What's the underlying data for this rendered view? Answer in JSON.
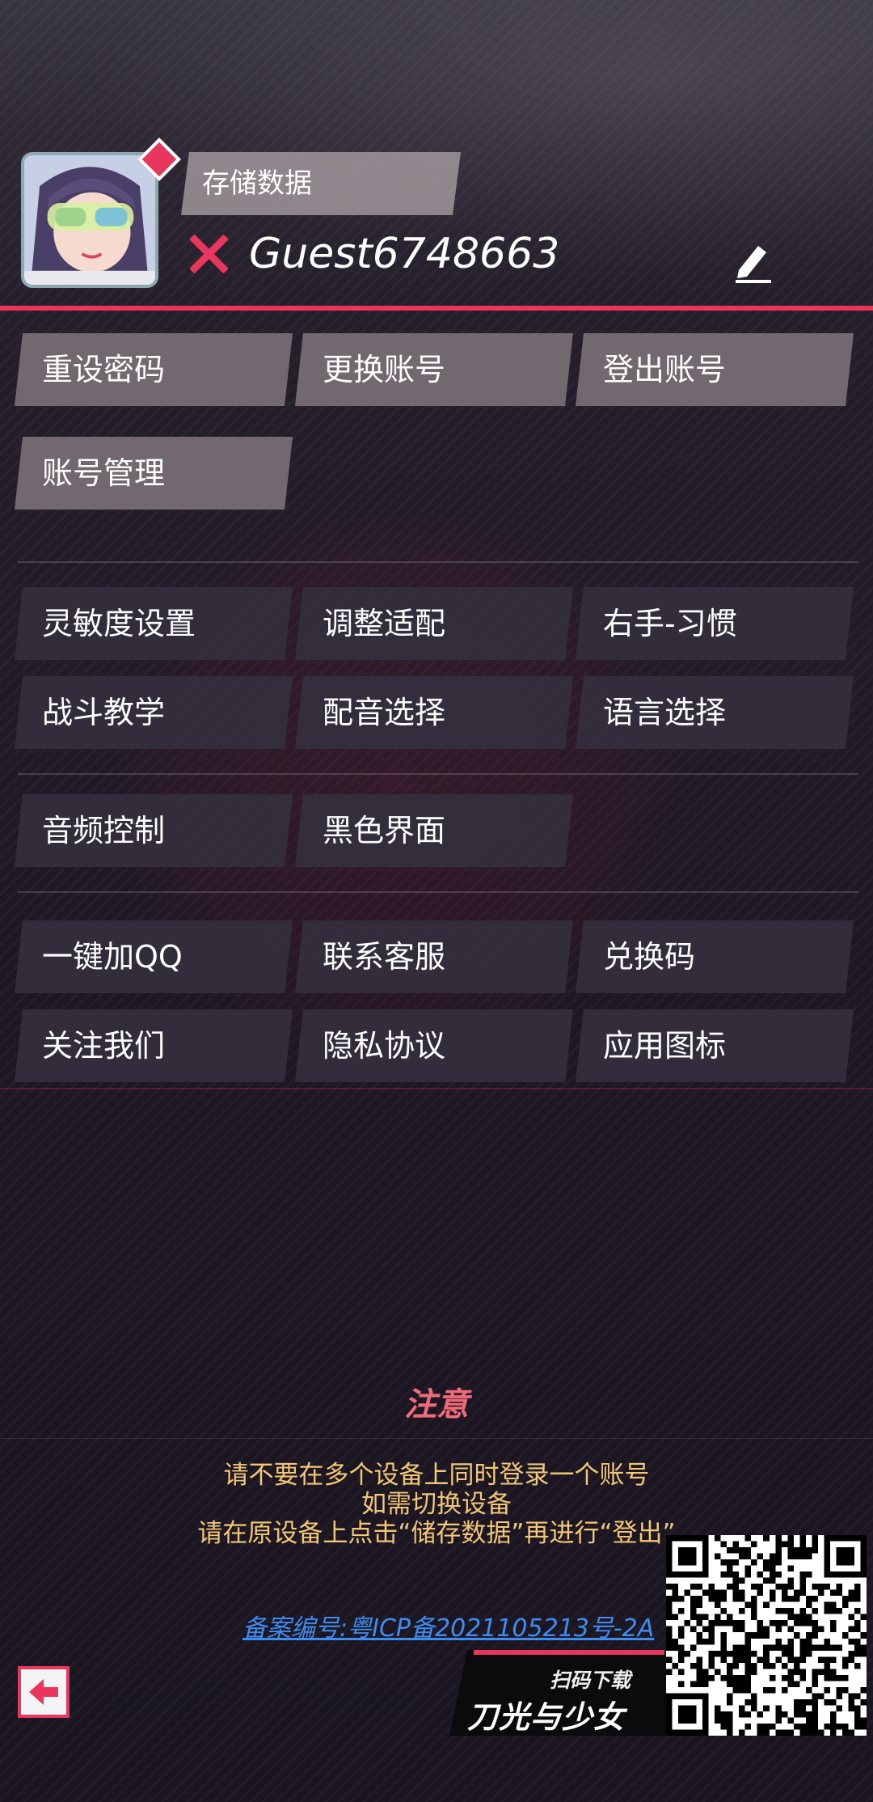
{
  "profile": {
    "save_data_label": "存储数据",
    "username": "Guest6748663",
    "login_status": "error",
    "avatar_icon": "character-avatar-icon",
    "edit_icon": "pencil-icon"
  },
  "account_buttons": [
    "重设密码",
    "更换账号",
    "登出账号",
    "账号管理"
  ],
  "settings_buttons": [
    "灵敏度设置",
    "调整适配",
    "右手-习惯",
    "战斗教学",
    "配音选择",
    "语言选择"
  ],
  "display_buttons": [
    "音频控制",
    "黑色界面"
  ],
  "service_buttons": [
    "一键加QQ",
    "联系客服",
    "兑换码",
    "关注我们",
    "隐私协议",
    "应用图标"
  ],
  "notice": {
    "title": "注意",
    "lines": [
      "请不要在多个设备上同时登录一个账号",
      "如需切换设备",
      "请在原设备上点击“储存数据”再进行“登出”"
    ]
  },
  "icp_link": "备案编号:粤ICP备2021105213号-2A",
  "back_icon": "back-arrow-icon",
  "promo": {
    "scan_label": "扫码下载",
    "game_title": "刀光与少女"
  },
  "colors": {
    "accent": "#e8365d",
    "notice_text": "#f2c776",
    "notice_title": "#f06b7a",
    "link": "#3f8cf0"
  }
}
